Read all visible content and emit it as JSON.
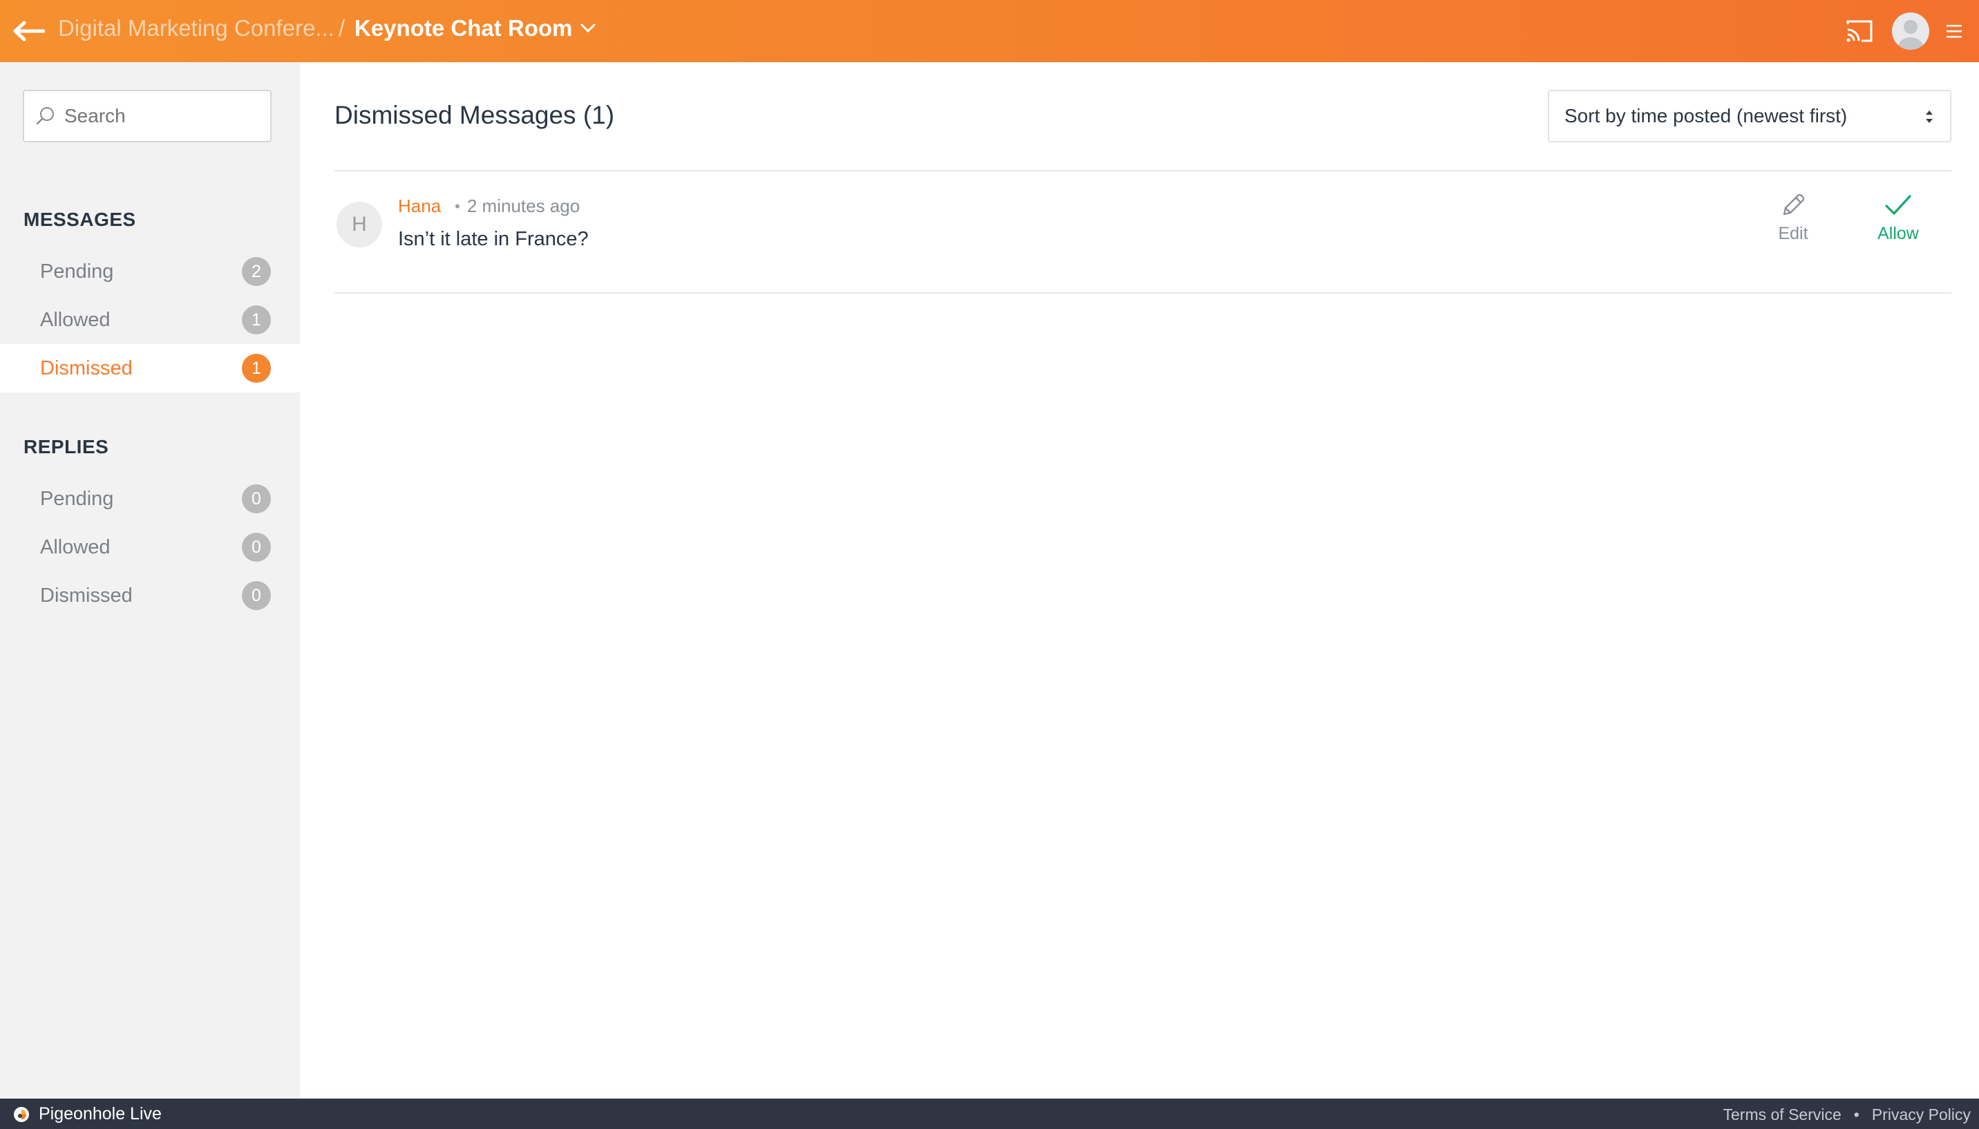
{
  "header": {
    "event_name": "Digital Marketing Confere...",
    "separator": "/",
    "room_name": "Keynote Chat Room"
  },
  "sidebar": {
    "search_placeholder": "Search",
    "messages_title": "MESSAGES",
    "messages": [
      {
        "label": "Pending",
        "count": "2"
      },
      {
        "label": "Allowed",
        "count": "1"
      },
      {
        "label": "Dismissed",
        "count": "1",
        "active": true
      }
    ],
    "replies_title": "REPLIES",
    "replies": [
      {
        "label": "Pending",
        "count": "0"
      },
      {
        "label": "Allowed",
        "count": "0"
      },
      {
        "label": "Dismissed",
        "count": "0"
      }
    ]
  },
  "main": {
    "title": "Dismissed Messages (1)",
    "sort_label": "Sort by time posted (newest first)",
    "messages": [
      {
        "avatar_initial": "H",
        "author": "Hana",
        "dot": "•",
        "time": "2 minutes ago",
        "text": "Isn’t it late in France?",
        "edit_label": "Edit",
        "allow_label": "Allow"
      }
    ]
  },
  "footer": {
    "brand": "Pigeonhole Live",
    "terms": "Terms of Service",
    "dot": "•",
    "privacy": "Privacy Policy"
  },
  "colors": {
    "header_orange": "#f47c2e",
    "active_orange": "#f47c2e",
    "allow_green": "#14a86f",
    "footer_bg": "#2f3542",
    "sidebar_bg": "#f2f2f2"
  },
  "icons": [
    "back-arrow-icon",
    "chevron-down-icon",
    "cast-icon",
    "user-avatar-icon",
    "hamburger-menu-icon",
    "search-icon",
    "sort-arrows-icon",
    "pencil-icon",
    "checkmark-icon",
    "pigeonhole-logo-icon"
  ]
}
